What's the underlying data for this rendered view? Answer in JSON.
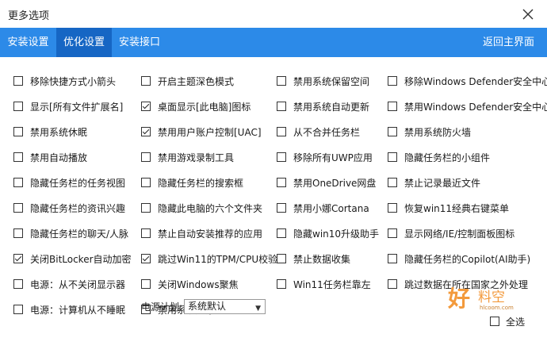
{
  "window": {
    "title": "更多选项"
  },
  "tabs": [
    {
      "label": "安装设置"
    },
    {
      "label": "优化设置"
    },
    {
      "label": "安装接口"
    }
  ],
  "back_label": "返回主界面",
  "options": [
    {
      "label": "移除快捷方式小箭头",
      "checked": false
    },
    {
      "label": "开启主题深色模式",
      "checked": false
    },
    {
      "label": "禁用系统保留空间",
      "checked": false
    },
    {
      "label": "移除Windows Defender安全中心",
      "checked": false
    },
    {
      "label": "显示[所有文件扩展名]",
      "checked": false
    },
    {
      "label": "桌面显示[此电脑]图标",
      "checked": true
    },
    {
      "label": "禁用系统自动更新",
      "checked": false
    },
    {
      "label": "禁用Windows Defender安全中心",
      "checked": false
    },
    {
      "label": "禁用系统休眠",
      "checked": false
    },
    {
      "label": "禁用用户账户控制[UAC]",
      "checked": true
    },
    {
      "label": "从不合并任务栏",
      "checked": false
    },
    {
      "label": "禁用系统防火墙",
      "checked": false
    },
    {
      "label": "禁用自动播放",
      "checked": false
    },
    {
      "label": "禁用游戏录制工具",
      "checked": false
    },
    {
      "label": "移除所有UWP应用",
      "checked": false
    },
    {
      "label": "隐藏任务栏的小组件",
      "checked": false
    },
    {
      "label": "隐藏任务栏的任务视图",
      "checked": false
    },
    {
      "label": "隐藏任务栏的搜索框",
      "checked": false
    },
    {
      "label": "禁用OneDrive网盘",
      "checked": false
    },
    {
      "label": "禁止记录最近文件",
      "checked": false
    },
    {
      "label": "隐藏任务栏的资讯兴趣",
      "checked": false
    },
    {
      "label": "隐藏此电脑的六个文件夹",
      "checked": false
    },
    {
      "label": "禁用小娜Cortana",
      "checked": false
    },
    {
      "label": "恢复win11经典右键菜单",
      "checked": false
    },
    {
      "label": "隐藏任务栏的聊天/人脉",
      "checked": false
    },
    {
      "label": "禁止自动安装推荐的应用",
      "checked": false
    },
    {
      "label": "隐藏win10升级助手",
      "checked": false
    },
    {
      "label": "显示网络/IE/控制面板图标",
      "checked": false
    },
    {
      "label": "关闭BitLocker自动加密",
      "checked": true
    },
    {
      "label": "跳过Win11的TPM/CPU校验",
      "checked": true
    },
    {
      "label": "禁止数据收集",
      "checked": false
    },
    {
      "label": "隐藏任务栏的Copilot(AI助手)",
      "checked": false
    },
    {
      "label": "电源：从不关闭显示器",
      "checked": false
    },
    {
      "label": "关闭Windows聚焦",
      "checked": false
    },
    {
      "label": "Win11任务栏靠左",
      "checked": false
    },
    {
      "label": "跳过数据在所在国家之外处理",
      "checked": false
    },
    {
      "label": "电源：计算机从不睡眠",
      "checked": false
    },
    {
      "label": "禁用系统还原",
      "checked": false
    }
  ],
  "power_plan": {
    "label": "电源计划:",
    "value": "系统默认"
  },
  "select_all": {
    "label": "全选",
    "checked": false
  },
  "watermark": {
    "big": "好",
    "small": "料空",
    "url": "hlcoom.com"
  }
}
